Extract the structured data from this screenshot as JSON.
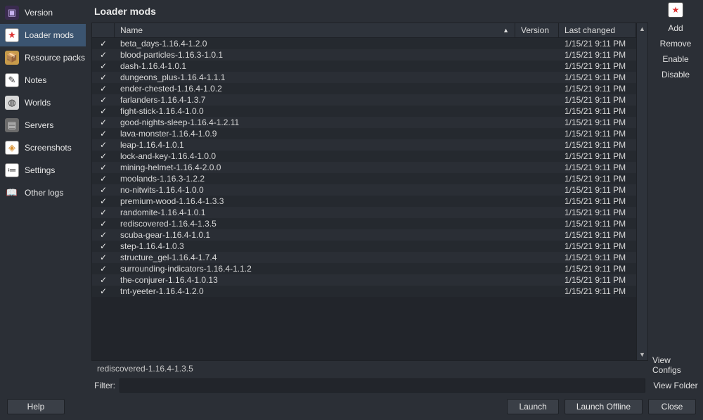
{
  "title": "Loader mods",
  "sidebar": {
    "items": [
      {
        "label": "Version",
        "icon": "cube",
        "glyph": "▣"
      },
      {
        "label": "Loader mods",
        "icon": "star",
        "glyph": "★",
        "selected": true
      },
      {
        "label": "Resource packs",
        "icon": "pack",
        "glyph": "📦"
      },
      {
        "label": "Notes",
        "icon": "notes",
        "glyph": "✎"
      },
      {
        "label": "Worlds",
        "icon": "worlds",
        "glyph": "◍"
      },
      {
        "label": "Servers",
        "icon": "servers",
        "glyph": "▤"
      },
      {
        "label": "Screenshots",
        "icon": "shots",
        "glyph": "◈"
      },
      {
        "label": "Settings",
        "icon": "settings",
        "glyph": "≔"
      },
      {
        "label": "Other logs",
        "icon": "logs",
        "glyph": "📖"
      }
    ]
  },
  "columns": {
    "name": "Name",
    "version": "Version",
    "changed": "Last changed"
  },
  "mods": [
    {
      "checked": true,
      "name": "beta_days-1.16.4-1.2.0",
      "version": "",
      "changed": "1/15/21 9:11 PM"
    },
    {
      "checked": true,
      "name": "blood-particles-1.16.3-1.0.1",
      "version": "",
      "changed": "1/15/21 9:11 PM"
    },
    {
      "checked": true,
      "name": "dash-1.16.4-1.0.1",
      "version": "",
      "changed": "1/15/21 9:11 PM"
    },
    {
      "checked": true,
      "name": "dungeons_plus-1.16.4-1.1.1",
      "version": "",
      "changed": "1/15/21 9:11 PM"
    },
    {
      "checked": true,
      "name": "ender-chested-1.16.4-1.0.2",
      "version": "",
      "changed": "1/15/21 9:11 PM"
    },
    {
      "checked": true,
      "name": "farlanders-1.16.4-1.3.7",
      "version": "",
      "changed": "1/15/21 9:11 PM"
    },
    {
      "checked": true,
      "name": "fight-stick-1.16.4-1.0.0",
      "version": "",
      "changed": "1/15/21 9:11 PM"
    },
    {
      "checked": true,
      "name": "good-nights-sleep-1.16.4-1.2.11",
      "version": "",
      "changed": "1/15/21 9:11 PM"
    },
    {
      "checked": true,
      "name": "lava-monster-1.16.4-1.0.9",
      "version": "",
      "changed": "1/15/21 9:11 PM"
    },
    {
      "checked": true,
      "name": "leap-1.16.4-1.0.1",
      "version": "",
      "changed": "1/15/21 9:11 PM"
    },
    {
      "checked": true,
      "name": "lock-and-key-1.16.4-1.0.0",
      "version": "",
      "changed": "1/15/21 9:11 PM"
    },
    {
      "checked": true,
      "name": "mining-helmet-1.16.4-2.0.0",
      "version": "",
      "changed": "1/15/21 9:11 PM"
    },
    {
      "checked": true,
      "name": "moolands-1.16.3-1.2.2",
      "version": "",
      "changed": "1/15/21 9:11 PM"
    },
    {
      "checked": true,
      "name": "no-nitwits-1.16.4-1.0.0",
      "version": "",
      "changed": "1/15/21 9:11 PM"
    },
    {
      "checked": true,
      "name": "premium-wood-1.16.4-1.3.3",
      "version": "",
      "changed": "1/15/21 9:11 PM"
    },
    {
      "checked": true,
      "name": "randomite-1.16.4-1.0.1",
      "version": "",
      "changed": "1/15/21 9:11 PM"
    },
    {
      "checked": true,
      "name": "rediscovered-1.16.4-1.3.5",
      "version": "",
      "changed": "1/15/21 9:11 PM"
    },
    {
      "checked": true,
      "name": "scuba-gear-1.16.4-1.0.1",
      "version": "",
      "changed": "1/15/21 9:11 PM"
    },
    {
      "checked": true,
      "name": "step-1.16.4-1.0.3",
      "version": "",
      "changed": "1/15/21 9:11 PM"
    },
    {
      "checked": true,
      "name": "structure_gel-1.16.4-1.7.4",
      "version": "",
      "changed": "1/15/21 9:11 PM"
    },
    {
      "checked": true,
      "name": "surrounding-indicators-1.16.4-1.1.2",
      "version": "",
      "changed": "1/15/21 9:11 PM"
    },
    {
      "checked": true,
      "name": "the-conjurer-1.16.4-1.0.13",
      "version": "",
      "changed": "1/15/21 9:11 PM"
    },
    {
      "checked": true,
      "name": "tnt-yeeter-1.16.4-1.2.0",
      "version": "",
      "changed": "1/15/21 9:11 PM"
    }
  ],
  "status": "rediscovered-1.16.4-1.3.5",
  "filter": {
    "label": "Filter:",
    "value": ""
  },
  "right": {
    "add": "Add",
    "remove": "Remove",
    "enable": "Enable",
    "disable": "Disable",
    "view_configs": "View Configs",
    "view_folder": "View Folder"
  },
  "bottom": {
    "help": "Help",
    "launch": "Launch",
    "launch_offline": "Launch Offline",
    "close": "Close"
  }
}
